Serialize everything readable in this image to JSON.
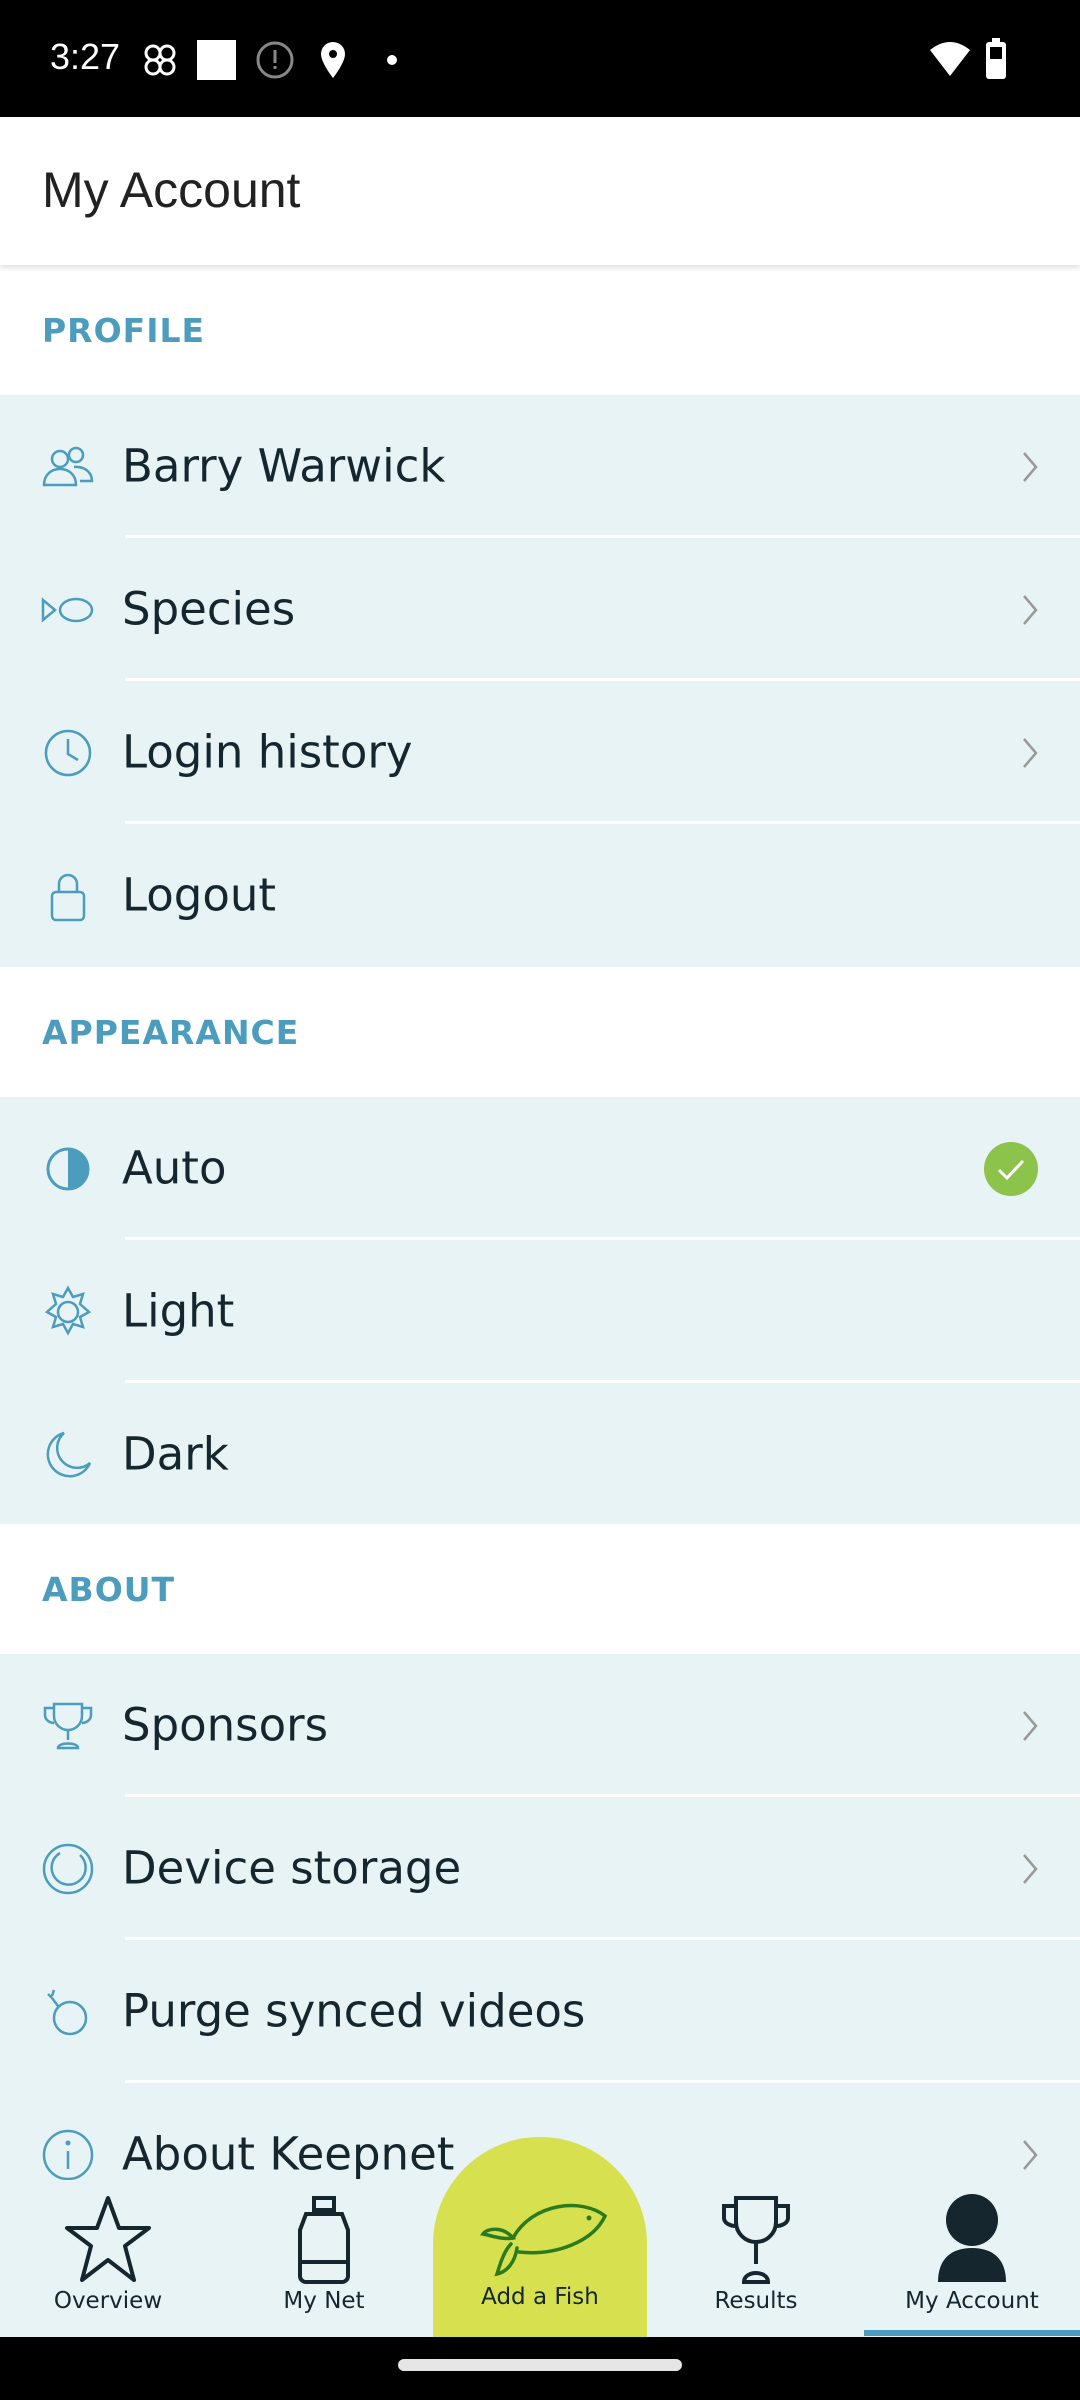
{
  "status_bar": {
    "time": "3:27",
    "icons": [
      "pinwheel-icon",
      "square-icon",
      "alert-circle-icon",
      "location-icon",
      "dot-icon",
      "wifi-icon",
      "battery-icon"
    ]
  },
  "header": {
    "title": "My Account"
  },
  "sections": {
    "profile": {
      "label": "PROFILE",
      "items": [
        {
          "label": "Barry Warwick",
          "icon": "users-icon"
        },
        {
          "label": "Species",
          "icon": "fish-outline-icon"
        },
        {
          "label": "Login history",
          "icon": "clock-icon"
        },
        {
          "label": "Logout",
          "icon": "lock-icon"
        }
      ]
    },
    "appearance": {
      "label": "APPEARANCE",
      "items": [
        {
          "label": "Auto",
          "icon": "half-circle-icon",
          "selected": true
        },
        {
          "label": "Light",
          "icon": "sun-icon"
        },
        {
          "label": "Dark",
          "icon": "moon-icon"
        }
      ]
    },
    "about": {
      "label": "ABOUT",
      "items": [
        {
          "label": "Sponsors",
          "icon": "trophy-icon"
        },
        {
          "label": "Device storage",
          "icon": "storage-ring-icon"
        },
        {
          "label": "Purge synced videos",
          "icon": "bomb-icon"
        },
        {
          "label": "About Keepnet",
          "icon": "info-icon"
        }
      ]
    }
  },
  "bottom_nav": {
    "tabs": [
      {
        "label": "Overview"
      },
      {
        "label": "My Net"
      },
      {
        "label": "Add a Fish"
      },
      {
        "label": "Results"
      },
      {
        "label": "My Account",
        "active": true
      }
    ]
  },
  "colors": {
    "accent": "#4b9cbd",
    "row_bg": "#e8f3f5",
    "fab": "#d7e04f",
    "check": "#8cc34a"
  }
}
